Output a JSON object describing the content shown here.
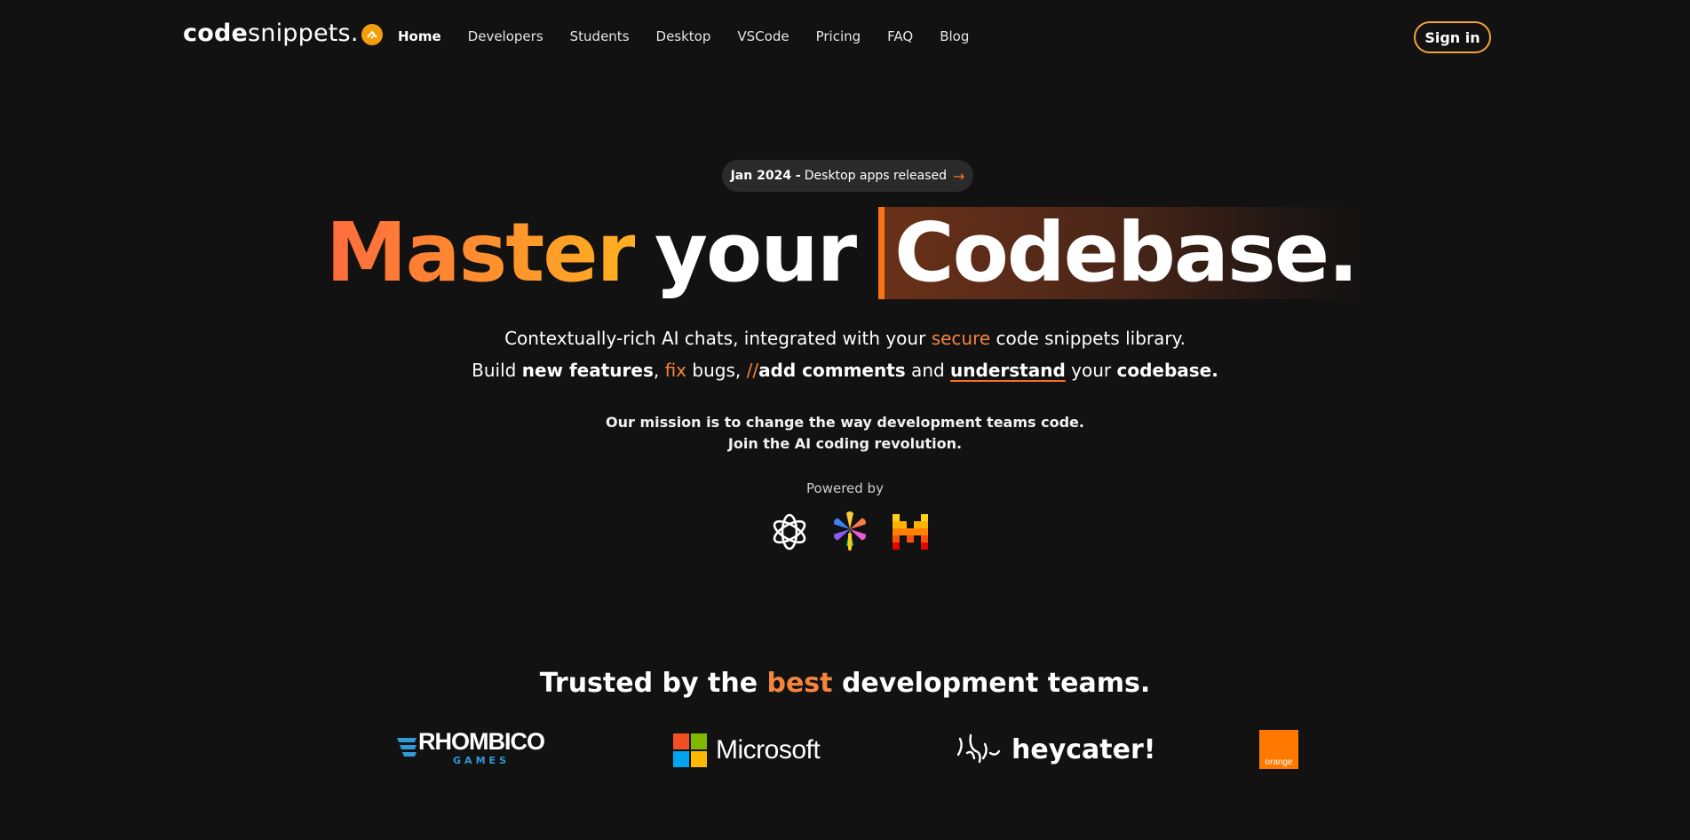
{
  "nav": {
    "logo": {
      "bold": "code",
      "light": "snippets."
    },
    "links": [
      {
        "label": "Home",
        "active": true
      },
      {
        "label": "Developers",
        "active": false
      },
      {
        "label": "Students",
        "active": false
      },
      {
        "label": "Desktop",
        "active": false
      },
      {
        "label": "VSCode",
        "active": false
      },
      {
        "label": "Pricing",
        "active": false
      },
      {
        "label": "FAQ",
        "active": false
      },
      {
        "label": "Blog",
        "active": false
      }
    ],
    "signin_label": "Sign in"
  },
  "announcement": {
    "strong": "Jan 2024 -",
    "text": "Desktop apps released",
    "arrow": "→"
  },
  "hero": {
    "word1": "Master",
    "word2": "your",
    "word3": "Codebase."
  },
  "subline1": {
    "pre": "Contextually-rich AI chats, integrated with your ",
    "highlight": "secure",
    "post": " code snippets library."
  },
  "subline2": {
    "p1": "Build ",
    "b1": "new features",
    "p2": ", ",
    "o1": "fix",
    "p3": " bugs, ",
    "o2": "//",
    "b2": "add comments",
    "p4": " and ",
    "u1": "understand",
    "p5": " your ",
    "b3": "codebase."
  },
  "mission": {
    "line1": "Our mission is to change the way development teams code.",
    "line2": "Join the AI coding revolution."
  },
  "powered_by": {
    "label": "Powered by",
    "logos": [
      "openai-logo-icon",
      "pinwheel-logo-icon",
      "mistral-logo-icon"
    ]
  },
  "trusted": {
    "pre": "Trusted by the ",
    "highlight": "best",
    "post": " development teams."
  },
  "clients": {
    "rhombico": {
      "name": "RHOMBICO",
      "sub": "GAMES"
    },
    "microsoft": {
      "name": "Microsoft"
    },
    "heycater": {
      "name": "heycater!"
    },
    "orange": {
      "name": "orange"
    }
  },
  "colors": {
    "background": "#121212",
    "accent": "#f97316",
    "accent_light": "#f5843c",
    "text": "#ffffff"
  }
}
